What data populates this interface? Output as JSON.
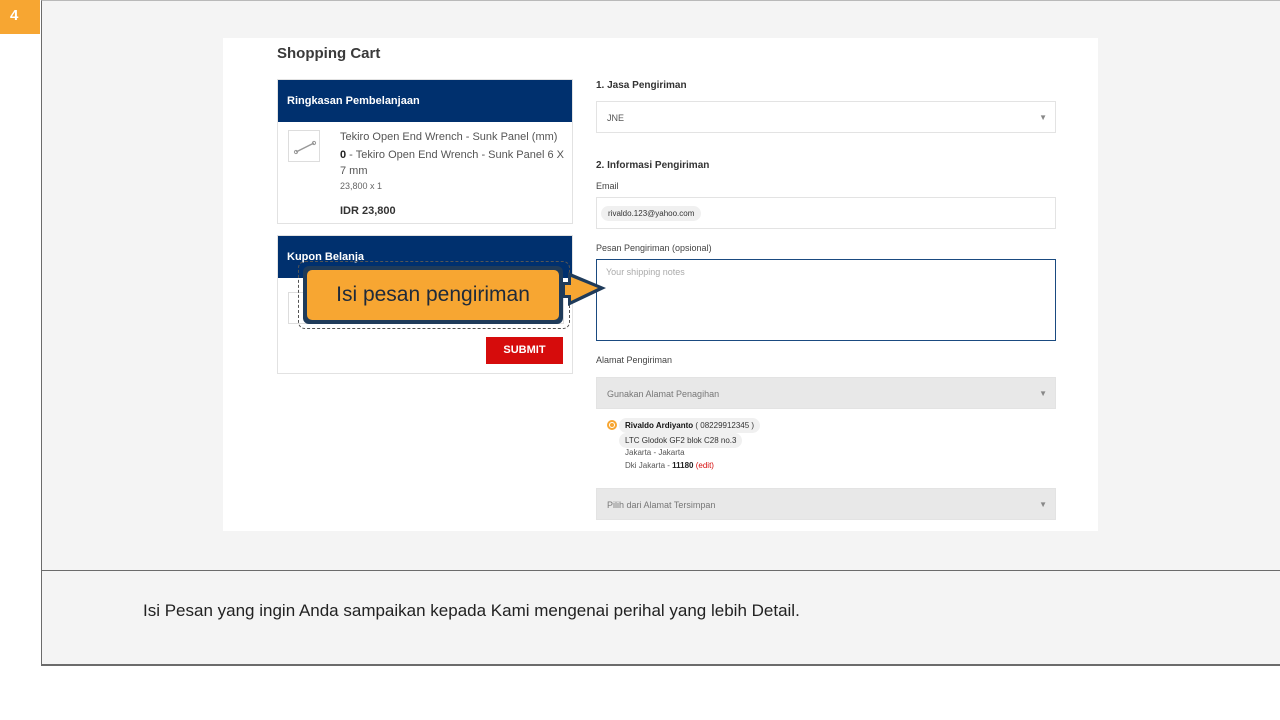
{
  "step_number": "4",
  "page_title": "Shopping Cart",
  "summary": {
    "header": "Ringkasan Pembelanjaan",
    "product_name": "Tekiro Open End Wrench - Sunk Panel (mm)",
    "variant_qty": "0",
    "variant_name": " - Tekiro Open End Wrench - Sunk Panel 6 X 7 mm",
    "price_qty": "23,800 x 1",
    "total": "IDR 23,800"
  },
  "coupon": {
    "header": "Kupon Belanja",
    "submit_label": "SUBMIT"
  },
  "shipping": {
    "section1_title": "1. Jasa Pengiriman",
    "courier_value": "JNE",
    "section2_title": "2. Informasi Pengiriman",
    "email_label": "Email",
    "email_value": "rivaldo.123@yahoo.com",
    "notes_label": "Pesan Pengiriman (opsional)",
    "notes_placeholder": "Your shipping notes",
    "address_label": "Alamat Pengiriman",
    "billing_select": "Gunakan Alamat Penagihan",
    "saved_select": "Pilih dari Alamat Tersimpan"
  },
  "address": {
    "name": "Rivaldo Ardiyanto",
    "phone": " ( 08229912345 )",
    "street": "LTC Glodok GF2 blok C28 no.3",
    "city": "Jakarta - Jakarta",
    "province": "Dki Jakarta - ",
    "postal": "11180",
    "edit_label": " (edit)"
  },
  "callout_text": "Isi pesan pengiriman",
  "caption": "Isi Pesan yang ingin Anda sampaikan kepada Kami mengenai perihal yang lebih Detail.",
  "colors": {
    "accent": "#f7a632",
    "header_blue": "#00306e",
    "submit_red": "#d60c0c"
  }
}
